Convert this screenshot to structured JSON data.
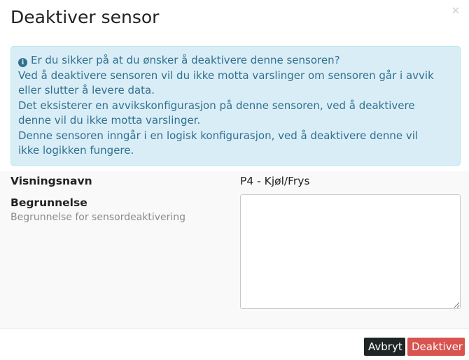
{
  "dialog": {
    "title": "Deaktiver sensor",
    "close_symbol": "×"
  },
  "alert": {
    "icon": "info-circle-icon",
    "icon_glyph": "i",
    "lines": [
      "Er du sikker på at du ønsker å deaktivere denne sensoren?",
      "Ved å deaktivere sensoren vil du ikke motta varslinger om sensoren går i avvik",
      "eller slutter å levere data.",
      "Det eksisterer en avvikskonfigurasjon på denne sensoren, ved å deaktivere",
      "denne vil du ikke motta varslinger.",
      "Denne sensoren inngår i en logisk konfigurasjon, ved å deaktivere denne vil",
      "ikke logikken fungere."
    ]
  },
  "form": {
    "display_name_label": "Visningsnavn",
    "display_name_value": "P4 - Kjøl/Frys",
    "reason_label": "Begrunnelse",
    "reason_help": "Begrunnelse for sensordeaktivering",
    "reason_value": ""
  },
  "footer": {
    "cancel_label": "Avbryt",
    "deactivate_label": "Deaktiver"
  },
  "colors": {
    "alert_bg": "#d9edf7",
    "alert_text": "#31708f",
    "danger": "#d9534f",
    "dark_button": "#1f2424"
  }
}
